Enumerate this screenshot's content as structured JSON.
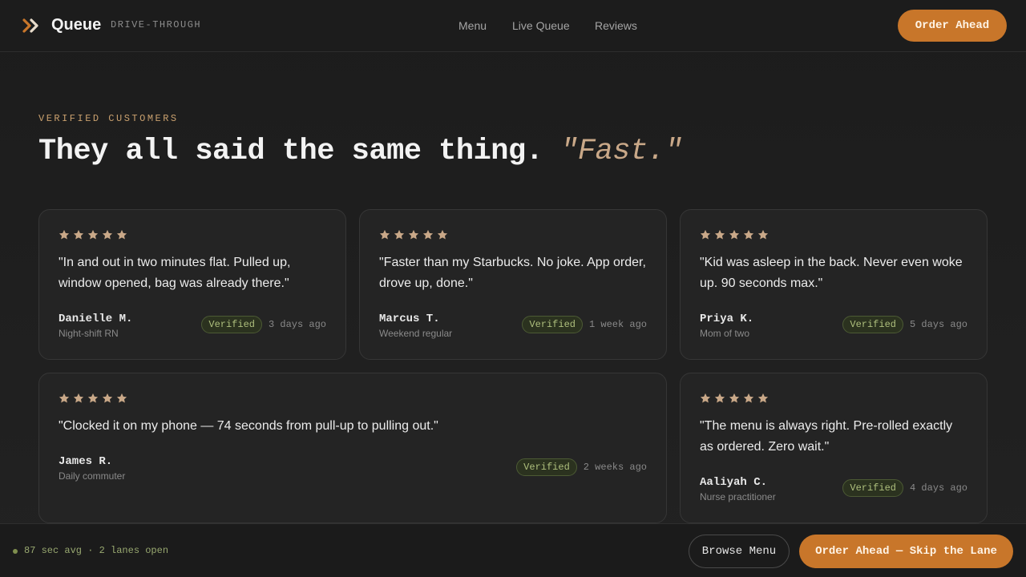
{
  "header": {
    "brand": "Queue",
    "brand_sub": "DRIVE-THROUGH",
    "logo_icon": "double-chevron-icon",
    "nav": [
      {
        "label": "Menu"
      },
      {
        "label": "Live Queue"
      },
      {
        "label": "Reviews"
      }
    ],
    "order_label": "Order Ahead"
  },
  "hero": {
    "eyebrow": "VERIFIED CUSTOMERS",
    "headline": "They all said the same thing.",
    "headline_accent": "\"Fast.\""
  },
  "reviews": [
    {
      "rating": 5,
      "quote": "\"In and out in two minutes flat. Pulled up, window opened, bag was already there.\"",
      "name": "Danielle M.",
      "role": "Night-shift RN",
      "badge": "Verified",
      "ago": "3 days ago"
    },
    {
      "rating": 5,
      "quote": "\"Faster than my Starbucks. No joke. App order, drove up, done.\"",
      "name": "Marcus T.",
      "role": "Weekend regular",
      "badge": "Verified",
      "ago": "1 week ago"
    },
    {
      "rating": 5,
      "quote": "\"Kid was asleep in the back. Never even woke up. 90 seconds max.\"",
      "name": "Priya K.",
      "role": "Mom of two",
      "badge": "Verified",
      "ago": "5 days ago"
    },
    {
      "rating": 5,
      "quote": "\"Clocked it on my phone — 74 seconds from pull-up to pulling out.\"",
      "name": "James R.",
      "role": "Daily commuter",
      "badge": "Verified",
      "ago": "2 weeks ago"
    },
    {
      "rating": 5,
      "quote": "\"The menu is always right. Pre-rolled exactly as ordered. Zero wait.\"",
      "name": "Aaliyah C.",
      "role": "Nurse practitioner",
      "badge": "Verified",
      "ago": "4 days ago"
    }
  ],
  "footer": {
    "status": "87 sec avg · 2 lanes open",
    "browse_label": "Browse Menu",
    "skip_label": "Order Ahead — Skip the Lane"
  },
  "colors": {
    "background": "#1c1c1c",
    "accent": "#c8762a",
    "star": "#c9a888",
    "verified": "#aebf7d"
  }
}
